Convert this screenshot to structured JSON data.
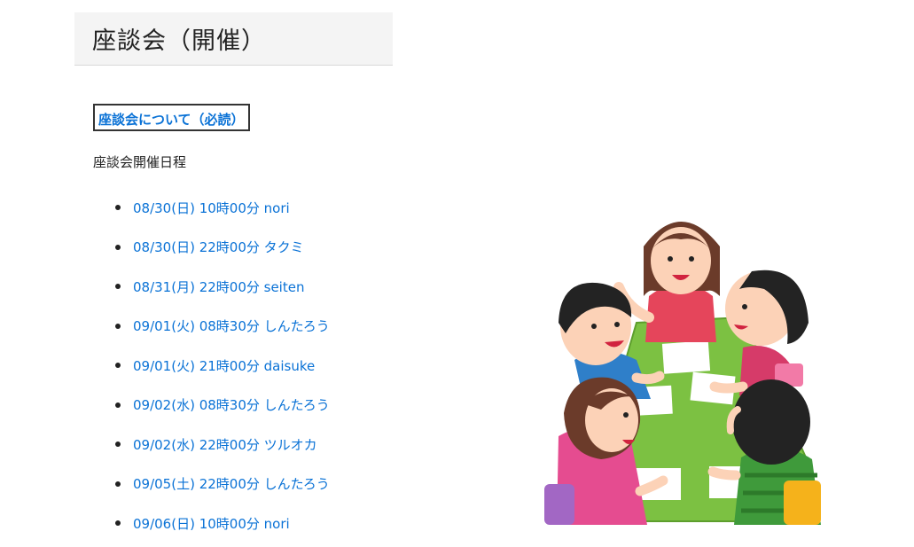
{
  "header": {
    "title": "座談会（開催）"
  },
  "about_link": {
    "label": "座談会について（必読）"
  },
  "schedule": {
    "heading": "座談会開催日程",
    "items": [
      {
        "label": "08/30(日) 10時00分 nori"
      },
      {
        "label": "08/30(日) 22時00分 タクミ"
      },
      {
        "label": "08/31(月) 22時00分 seiten"
      },
      {
        "label": "09/01(火) 08時30分 しんたろう"
      },
      {
        "label": "09/01(火) 21時00分 daisuke"
      },
      {
        "label": "09/02(水) 08時30分 しんたろう"
      },
      {
        "label": "09/02(水) 22時00分 ツルオカ"
      },
      {
        "label": "09/05(土) 22時00分 しんたろう"
      },
      {
        "label": "09/06(日) 10時00分 nori"
      }
    ]
  },
  "colors": {
    "link": "#0a72d6",
    "header_bg": "#f4f4f4",
    "table": "#7cc142"
  },
  "illustration": {
    "icon": "meeting-people-around-table-illustration"
  }
}
